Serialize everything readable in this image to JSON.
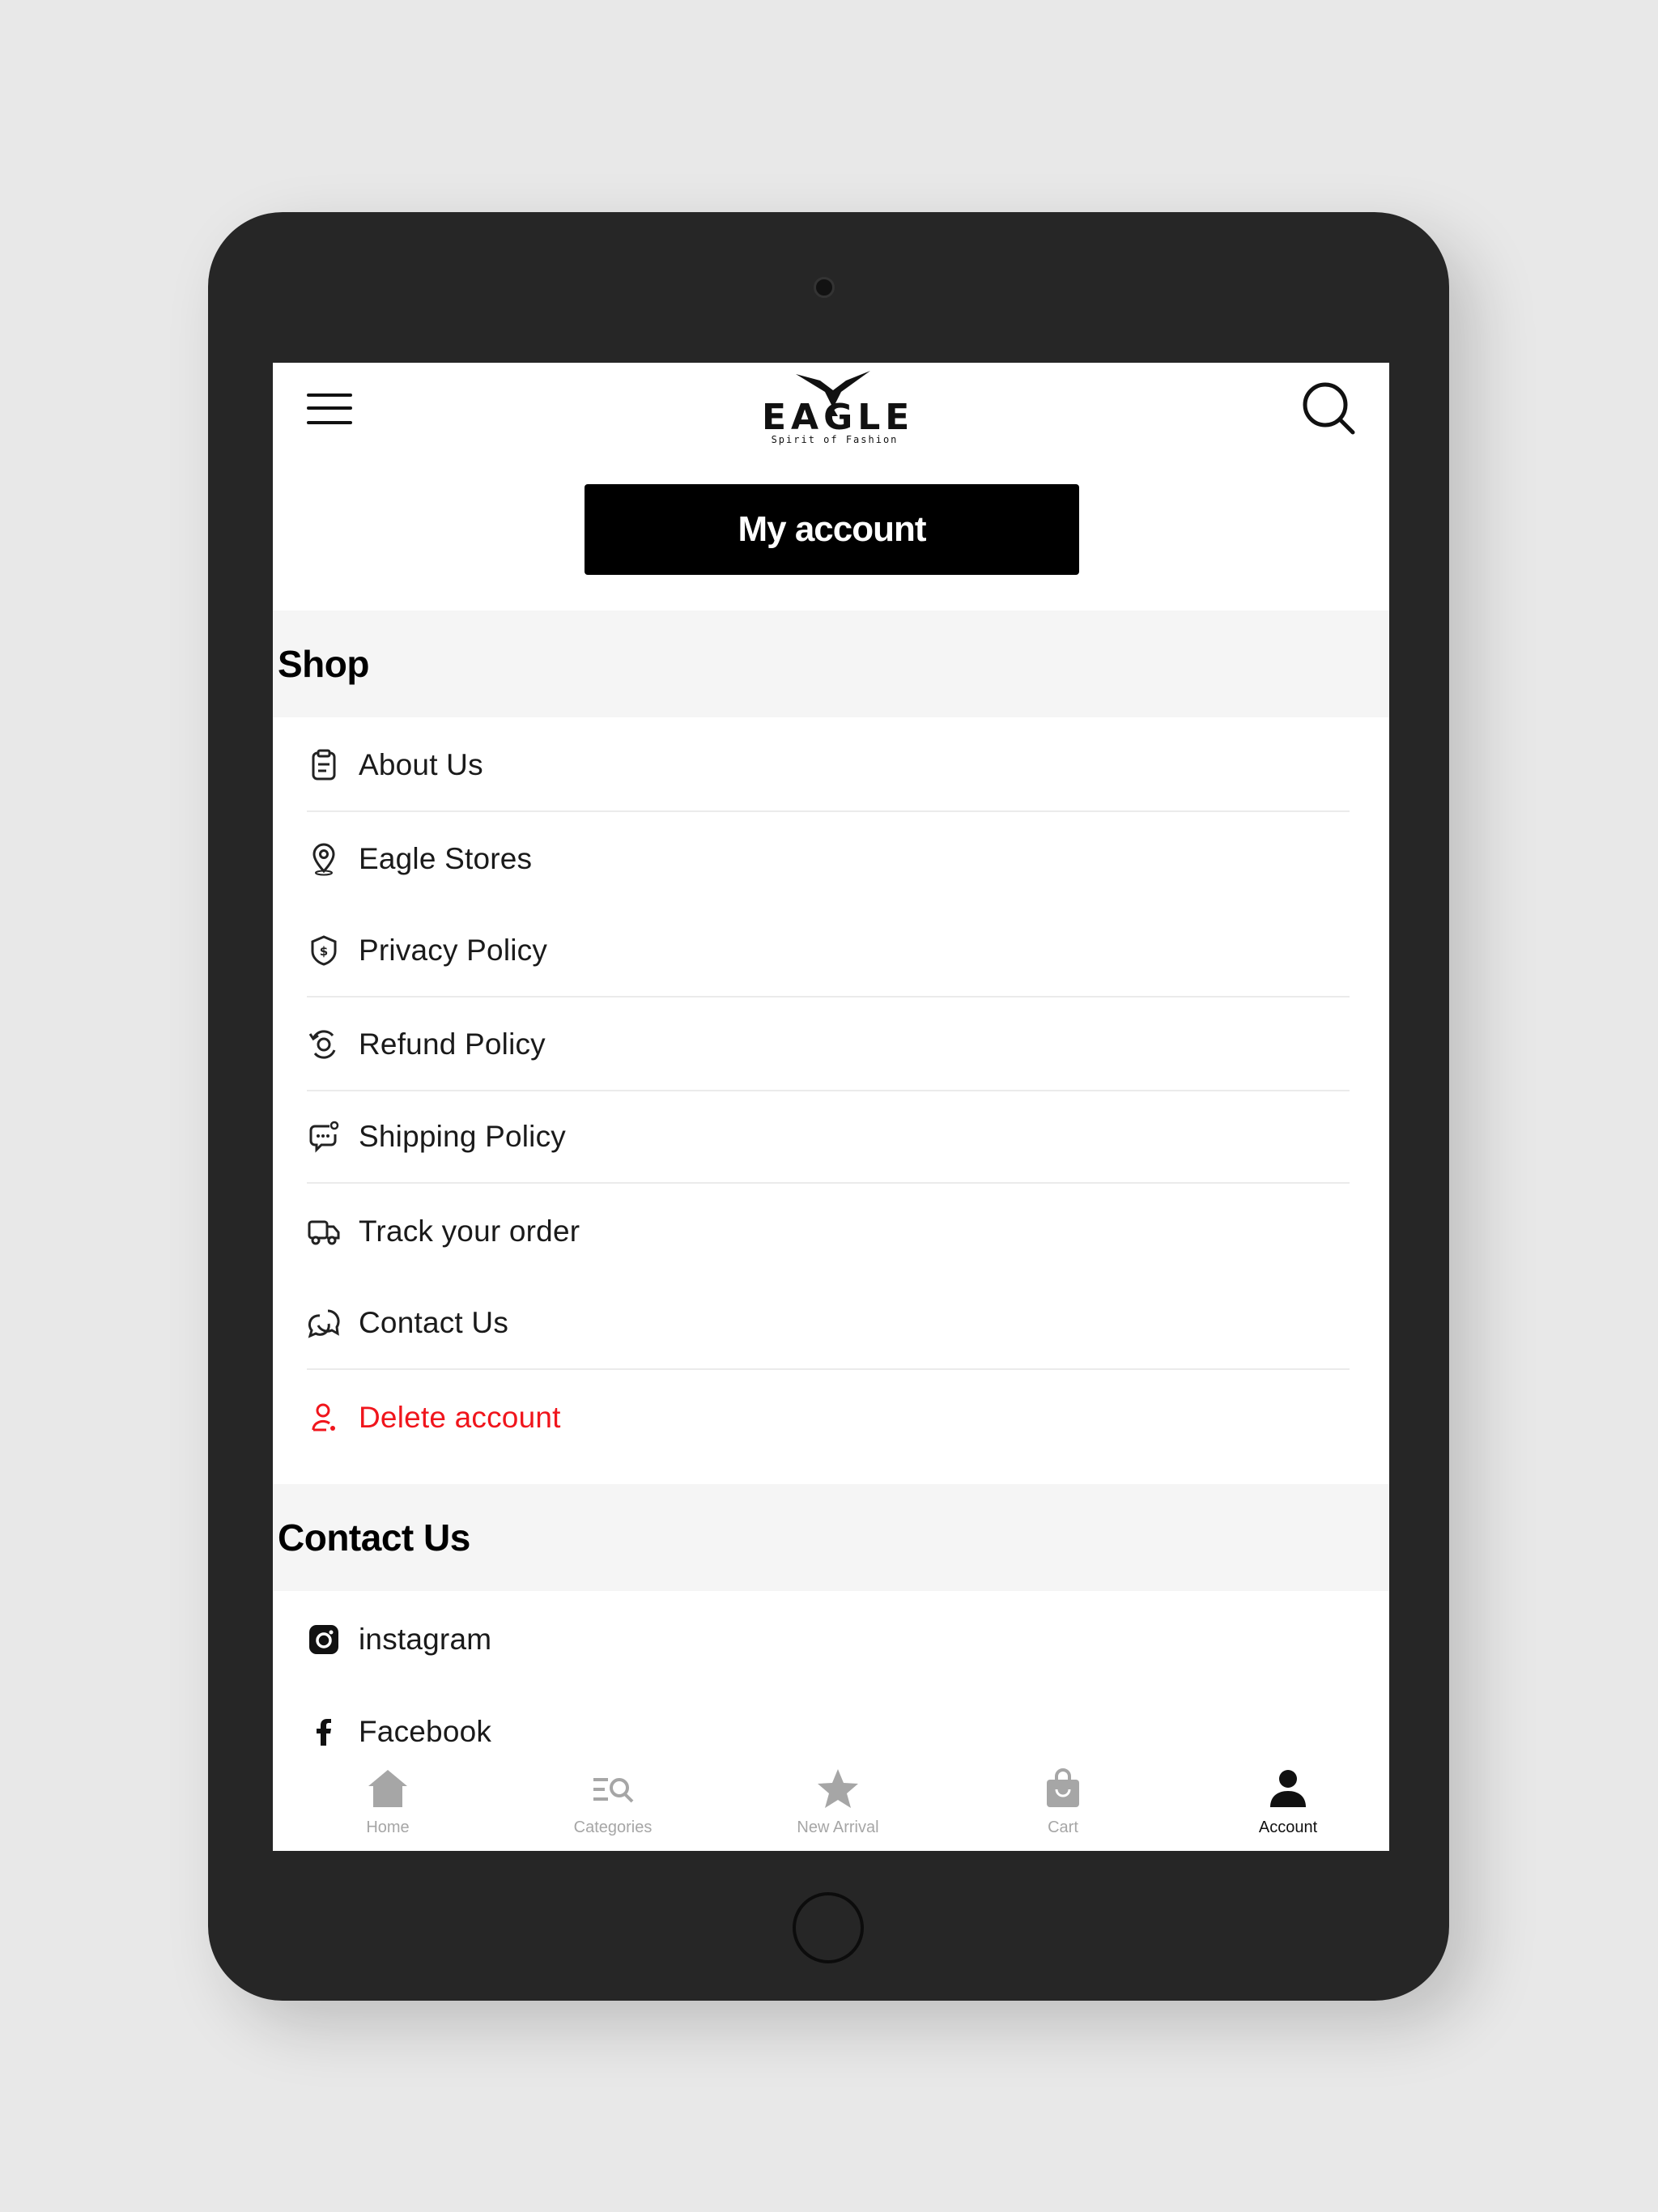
{
  "brand": {
    "name": "EAGLE",
    "tagline": "Spirit of Fashion"
  },
  "header": {
    "account_button": "My account"
  },
  "shop_section": {
    "title": "Shop",
    "items": [
      {
        "label": "About Us",
        "icon": "clipboard-icon"
      },
      {
        "label": "Eagle Stores",
        "icon": "location-pin-icon"
      },
      {
        "label": "Privacy Policy",
        "icon": "shield-dollar-icon"
      },
      {
        "label": "Refund Policy",
        "icon": "refund-cycle-icon"
      },
      {
        "label": "Shipping Policy",
        "icon": "chat-settings-icon"
      },
      {
        "label": "Track your order",
        "icon": "truck-icon"
      },
      {
        "label": "Contact Us",
        "icon": "chat-bubbles-icon"
      },
      {
        "label": "Delete account",
        "icon": "user-remove-icon"
      }
    ]
  },
  "contact_section": {
    "title": "Contact Us",
    "items": [
      {
        "label": "instagram",
        "icon": "instagram-icon"
      },
      {
        "label": "Facebook",
        "icon": "facebook-icon"
      }
    ]
  },
  "bottom_nav": {
    "items": [
      {
        "label": "Home",
        "icon": "home-icon"
      },
      {
        "label": "Categories",
        "icon": "categories-icon"
      },
      {
        "label": "New Arrival",
        "icon": "star-icon"
      },
      {
        "label": "Cart",
        "icon": "shopping-bag-icon"
      },
      {
        "label": "Account",
        "icon": "user-icon"
      }
    ],
    "active": "Account"
  },
  "colors": {
    "danger": "#f0151c",
    "primary": "#000000",
    "inactive": "#a6a6a6",
    "section_bg": "#f5f5f5"
  }
}
